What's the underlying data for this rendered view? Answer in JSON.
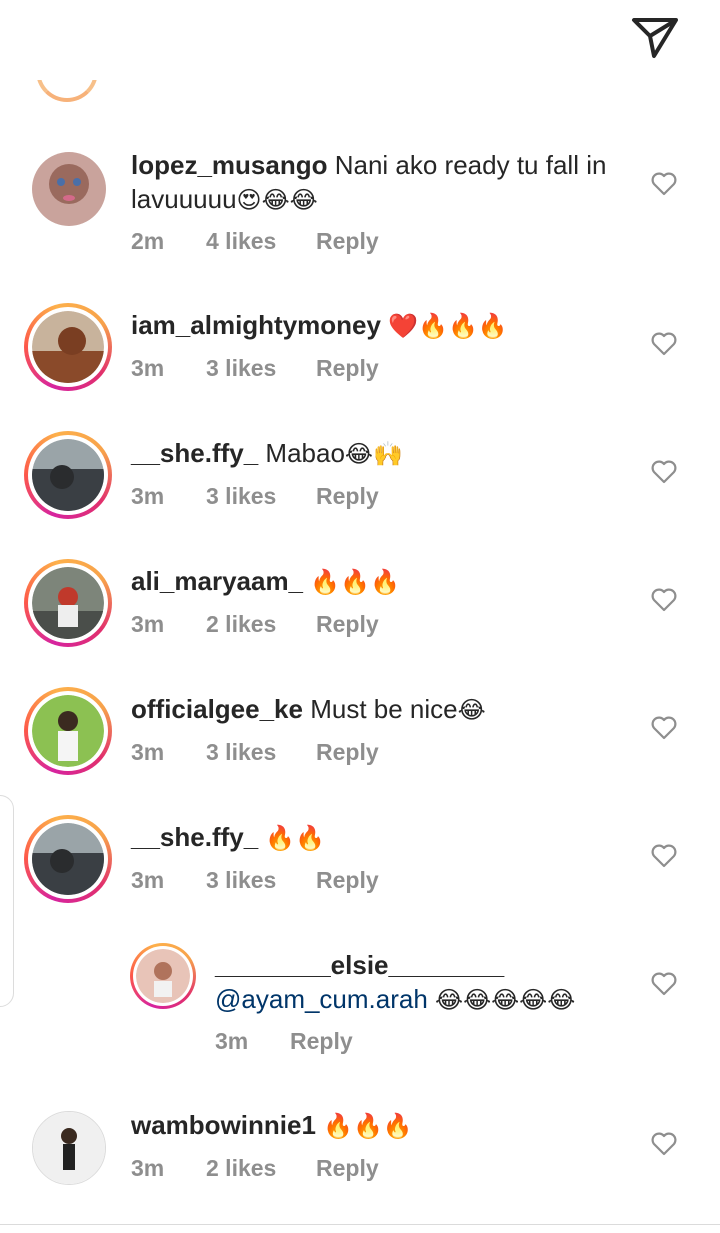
{
  "comments": [
    {
      "username": "lopez_musango",
      "text": "Nani ako ready tu fall in lavuuuuu",
      "emoji": "😍😂😂",
      "time": "2m",
      "likes": "4 likes",
      "reply": "Reply",
      "avatar_color": "#b88a86"
    },
    {
      "username": "iam_almightymoney",
      "text": "",
      "emoji": "❤️🔥🔥🔥",
      "time": "3m",
      "likes": "3 likes",
      "reply": "Reply",
      "avatar_color": "#8a4a2a"
    },
    {
      "username": "__she.ffy_",
      "text": "Mabao",
      "emoji": "😂🙌",
      "time": "3m",
      "likes": "3 likes",
      "reply": "Reply",
      "avatar_color": "#3a3f44"
    },
    {
      "username": "ali_maryaam_",
      "text": "",
      "emoji": "🔥🔥🔥",
      "time": "3m",
      "likes": "2 likes",
      "reply": "Reply",
      "avatar_color": "#5b5f5a"
    },
    {
      "username": "officialgee_ke",
      "text": "Must be nice",
      "emoji": "😂",
      "time": "3m",
      "likes": "3 likes",
      "reply": "Reply",
      "avatar_color": "#6ea84a"
    },
    {
      "username": "__she.ffy_",
      "text": "",
      "emoji": "🔥🔥",
      "time": "3m",
      "likes": "3 likes",
      "reply": "Reply",
      "avatar_color": "#3a3f44"
    },
    {
      "username": "________elsie________",
      "mention": "@ayam_cum.arah",
      "emoji": "😂😂😂😂😂",
      "time": "3m",
      "reply": "Reply",
      "avatar_color": "#d9a497"
    },
    {
      "username": "wambowinnie1",
      "text": "",
      "emoji": "🔥🔥🔥",
      "time": "3m",
      "likes": "2 likes",
      "reply": "Reply",
      "avatar_color": "#cfcfcf"
    }
  ],
  "icons": {
    "send": "send-icon",
    "like": "heart-icon"
  }
}
